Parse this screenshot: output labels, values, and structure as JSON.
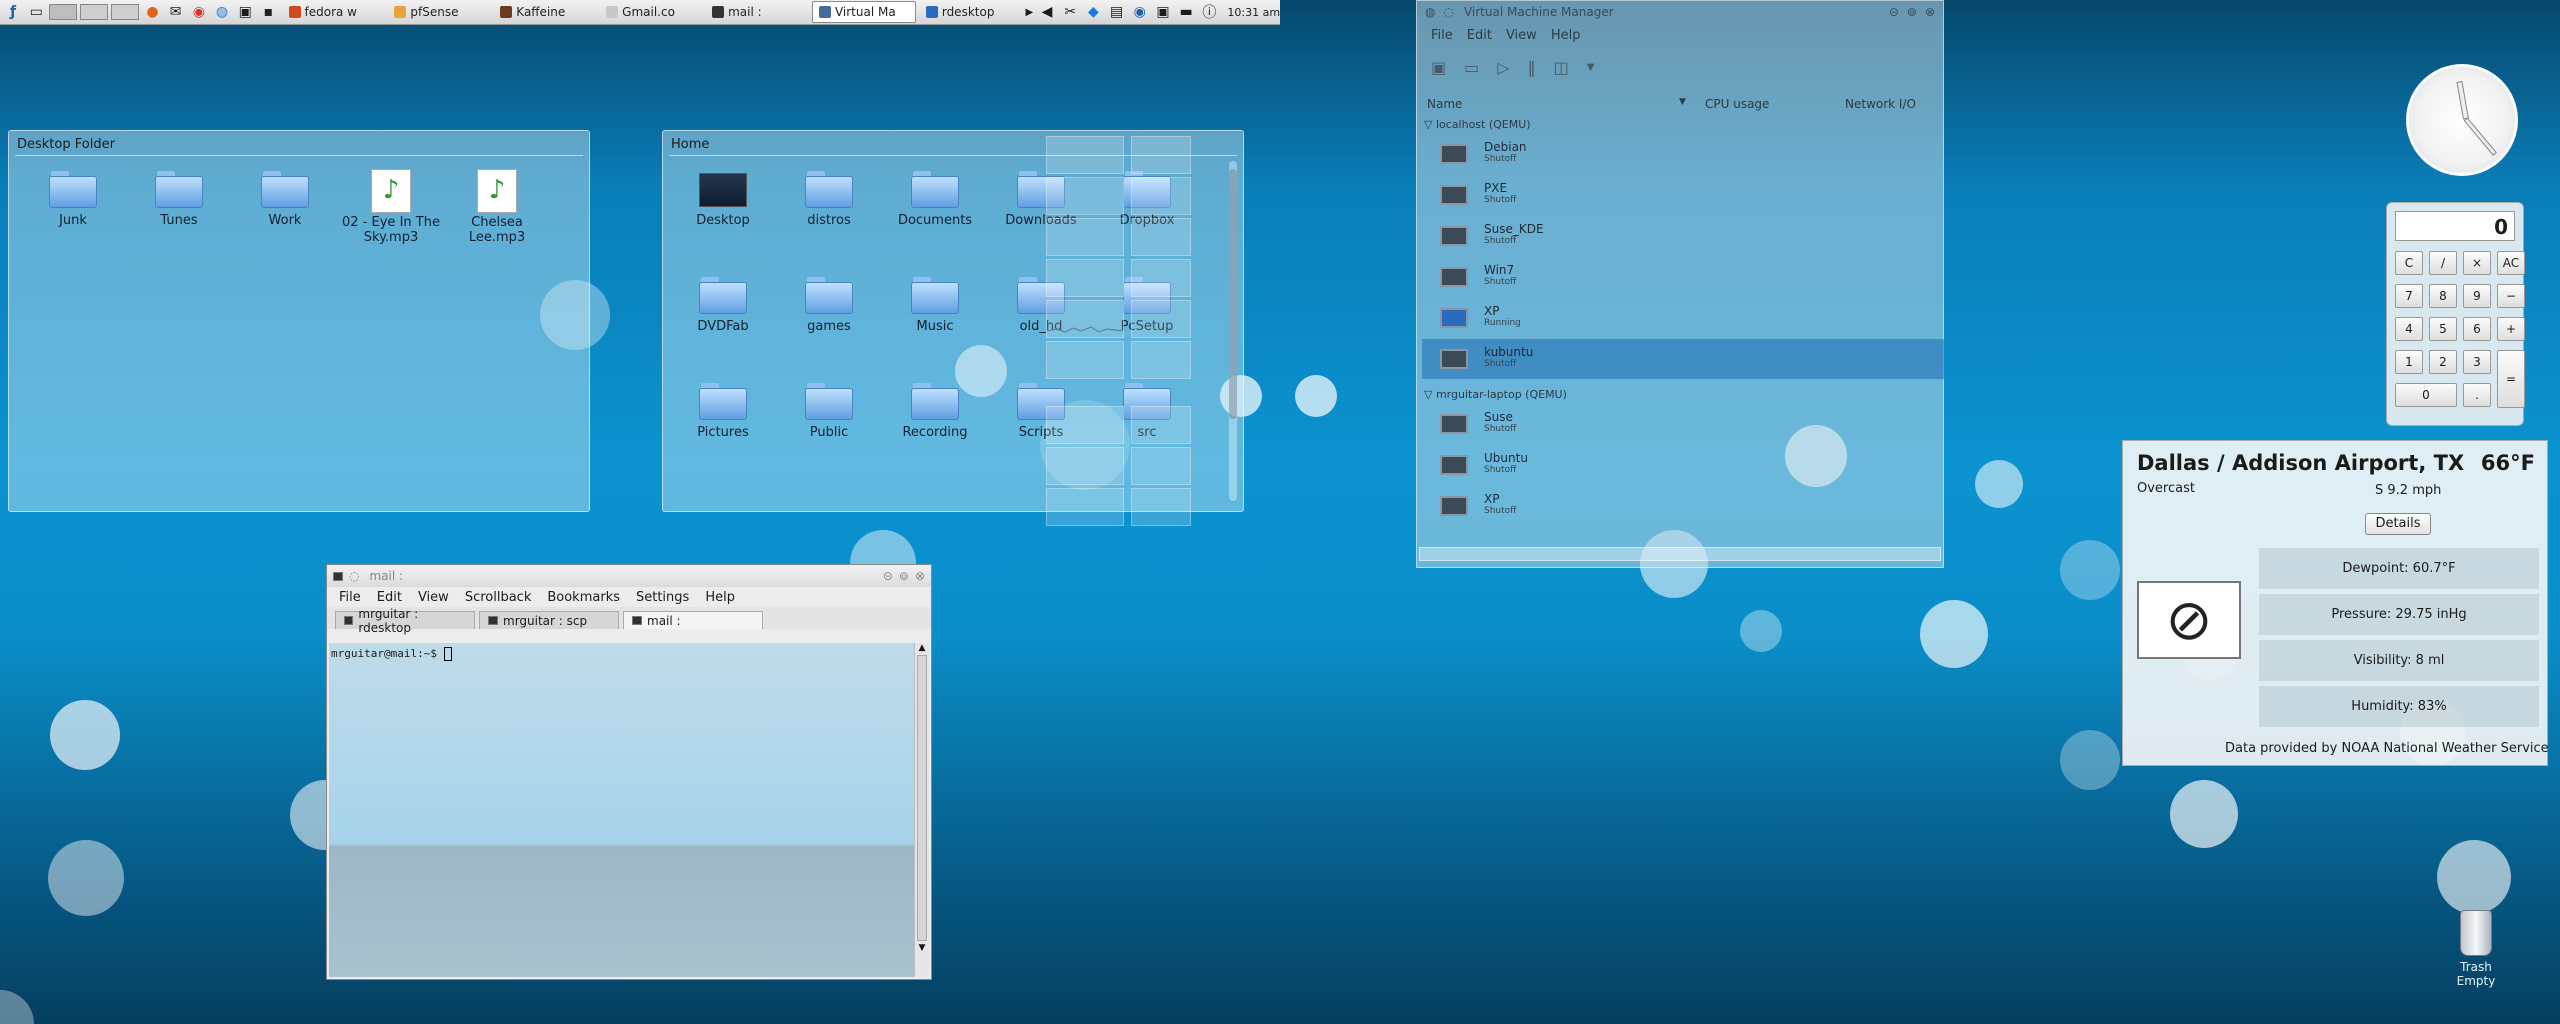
{
  "panel": {
    "tasks": [
      {
        "label": "fedora w",
        "color": "#d04a1e"
      },
      {
        "label": "pfSense",
        "color": "#e8a33a"
      },
      {
        "label": "Kaffeine",
        "color": "#6a3a1e"
      },
      {
        "label": "Gmail.co",
        "color": "#c8c8c8"
      },
      {
        "label": "mail :",
        "color": "#333333"
      },
      {
        "label": "Virtual Ma",
        "color": "#4a6a9a"
      },
      {
        "label": "rdesktop",
        "color": "#2a6abf"
      }
    ],
    "clock": "10:31 am"
  },
  "desktop_folder": {
    "title": "Desktop Folder",
    "items": [
      "Junk",
      "Tunes",
      "Work",
      "02 - Eye In The Sky.mp3",
      "Chelsea Lee.mp3"
    ]
  },
  "home": {
    "title": "Home",
    "items": [
      "Desktop",
      "distros",
      "Documents",
      "Downloads",
      "Dropbox",
      "DVDFab",
      "games",
      "Music",
      "old_hd",
      "PcSetup",
      "Pictures",
      "Public",
      "Recording",
      "Scripts",
      "src"
    ]
  },
  "terminal": {
    "title": "mail :",
    "menu": [
      "File",
      "Edit",
      "View",
      "Scrollback",
      "Bookmarks",
      "Settings",
      "Help"
    ],
    "tabs": [
      "mrguitar : rdesktop",
      "mrguitar : scp",
      "mail :"
    ],
    "prompt": "mrguitar@mail:~$"
  },
  "vmm": {
    "title": "Virtual Machine Manager",
    "menu": [
      "File",
      "Edit",
      "View",
      "Help"
    ],
    "columns": [
      "Name",
      "CPU usage",
      "Network I/O"
    ],
    "groups": [
      {
        "label": "localhost (QEMU)",
        "vms": [
          {
            "name": "Debian",
            "status": "Shutoff"
          },
          {
            "name": "PXE",
            "status": "Shutoff"
          },
          {
            "name": "Suse_KDE",
            "status": "Shutoff"
          },
          {
            "name": "Win7",
            "status": "Shutoff"
          },
          {
            "name": "XP",
            "status": "Running"
          },
          {
            "name": "kubuntu",
            "status": "Shutoff"
          }
        ]
      },
      {
        "label": "mrguitar-laptop (QEMU)",
        "vms": [
          {
            "name": "Suse",
            "status": "Shutoff"
          },
          {
            "name": "Ubuntu",
            "status": "Shutoff"
          },
          {
            "name": "XP",
            "status": "Shutoff"
          }
        ]
      }
    ]
  },
  "calculator": {
    "display": "0",
    "keys": [
      "C",
      "/",
      "×",
      "AC",
      "7",
      "8",
      "9",
      "−",
      "4",
      "5",
      "6",
      "+",
      "1",
      "2",
      "3",
      "=",
      "0",
      "."
    ]
  },
  "weather": {
    "location": "Dallas / Addison Airport, TX",
    "temp": "66°F",
    "condition": "Overcast",
    "wind": "S 9.2 mph",
    "details_label": "Details",
    "dewpoint": "Dewpoint: 60.7°F",
    "pressure": "Pressure: 29.75 inHg",
    "visibility": "Visibility: 8 ml",
    "humidity": "Humidity: 83%",
    "credit": "Data provided by NOAA National Weather Service"
  },
  "trash": {
    "label": "Trash",
    "sublabel": "Empty"
  }
}
